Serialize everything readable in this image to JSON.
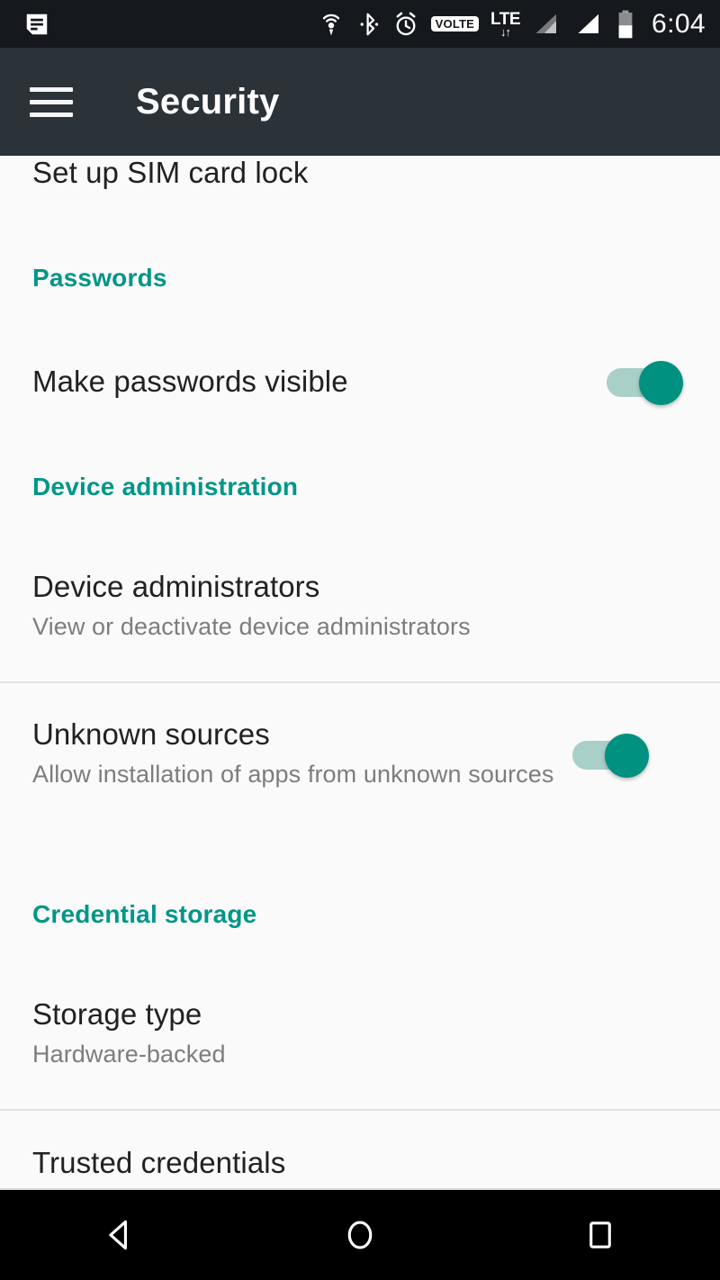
{
  "status_bar": {
    "notification_icon": "message-icon",
    "icons": [
      {
        "name": "hotspot-icon",
        "label": "hotspot"
      },
      {
        "name": "bluetooth-icon",
        "label": "bluetooth"
      },
      {
        "name": "alarm-icon",
        "label": "alarm"
      },
      {
        "name": "volte-badge",
        "label": "VOLTE"
      },
      {
        "name": "lte-icon",
        "label": "LTE"
      },
      {
        "name": "signal-sim1-icon",
        "label": "signal 1"
      },
      {
        "name": "signal-sim2-icon",
        "label": "signal 2"
      },
      {
        "name": "battery-icon",
        "label": "battery"
      }
    ],
    "lte_text": "LTE",
    "lte_arrows": "↓↑",
    "volte_text": "VOLTE",
    "clock": "6:04",
    "background": "#15181c"
  },
  "app_bar": {
    "menu_icon": "hamburger-menu-icon",
    "title": "Security",
    "background": "#2b3238"
  },
  "theme": {
    "accent": "#009688",
    "page_background": "#fafafa",
    "title_color": "#212121",
    "subtitle_color": "#7d7d7d",
    "divider_color": "#e3e3e3",
    "switch_track_on": "#a9cfc9",
    "switch_thumb_on": "#009180"
  },
  "content": {
    "partial_top_item": {
      "title": "Set up SIM card lock"
    },
    "sections": [
      {
        "header": "Passwords",
        "items": [
          {
            "title": "Make passwords visible",
            "subtitle": "",
            "control": "switch",
            "switch_state": "on"
          }
        ]
      },
      {
        "header": "Device administration",
        "items": [
          {
            "title": "Device administrators",
            "subtitle": "View or deactivate device administrators",
            "control": "none"
          },
          {
            "title": "Unknown sources",
            "subtitle": "Allow installation of apps from unknown sources",
            "control": "switch",
            "switch_state": "on"
          }
        ]
      },
      {
        "header": "Credential storage",
        "items": [
          {
            "title": "Storage type",
            "subtitle": "Hardware-backed",
            "control": "none"
          },
          {
            "title": "Trusted credentials",
            "subtitle": "",
            "control": "none"
          }
        ]
      }
    ]
  },
  "nav_bar": {
    "back": "back-button",
    "home": "home-button",
    "recents": "recents-button",
    "background": "#000000"
  }
}
